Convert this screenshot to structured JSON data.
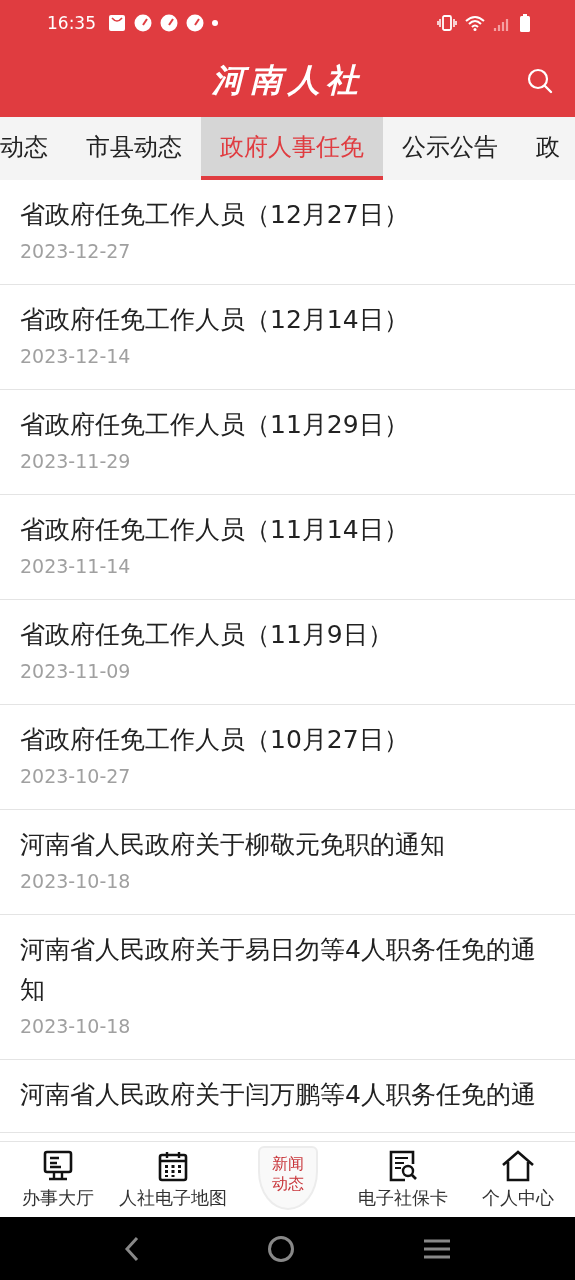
{
  "status_bar": {
    "time": "16:35"
  },
  "header": {
    "title": "河南人社"
  },
  "tabs": [
    {
      "label": "动态",
      "selected": false
    },
    {
      "label": "市县动态",
      "selected": false
    },
    {
      "label": "政府人事任免",
      "selected": true
    },
    {
      "label": "公示公告",
      "selected": false
    },
    {
      "label": "政",
      "selected": false
    }
  ],
  "articles": [
    {
      "title": "省政府任免工作人员（12月27日）",
      "date": "2023-12-27"
    },
    {
      "title": "省政府任免工作人员（12月14日）",
      "date": "2023-12-14"
    },
    {
      "title": "省政府任免工作人员（11月29日）",
      "date": "2023-11-29"
    },
    {
      "title": "省政府任免工作人员（11月14日）",
      "date": "2023-11-14"
    },
    {
      "title": "省政府任免工作人员（11月9日）",
      "date": "2023-11-09"
    },
    {
      "title": "省政府任免工作人员（10月27日）",
      "date": "2023-10-27"
    },
    {
      "title": "河南省人民政府关于柳敬元免职的通知",
      "date": "2023-10-18"
    },
    {
      "title": "河南省人民政府关于易日勿等4人职务任免的通知",
      "date": "2023-10-18"
    },
    {
      "title": "河南省人民政府关于闫万鹏等4人职务任免的通"
    }
  ],
  "bottom_nav": [
    {
      "kind": "hall",
      "label": "办事大厅"
    },
    {
      "kind": "map",
      "label": "人社电子地图"
    },
    {
      "kind": "badge",
      "label": "新闻动态"
    },
    {
      "kind": "card",
      "label": "电子社保卡"
    },
    {
      "kind": "home",
      "label": "个人中心"
    }
  ]
}
